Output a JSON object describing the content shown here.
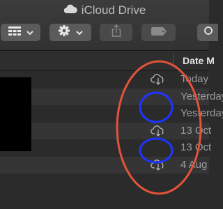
{
  "window": {
    "title": "iCloud Drive"
  },
  "toolbar": {
    "view_button": {
      "icon": "grid-view-icon"
    },
    "action_button": {
      "icon": "gear-icon"
    },
    "share_button": {
      "icon": "share-icon"
    },
    "tags_button": {
      "icon": "tag-icon"
    }
  },
  "columns": {
    "date": "Date M"
  },
  "files": [
    {
      "date": "Today",
      "status_icon": "cloud-download-icon"
    },
    {
      "date": "Yesterday",
      "status_icon": ""
    },
    {
      "date": "Yesterday",
      "status_icon": ""
    },
    {
      "date": "13 Oct",
      "status_icon": "cloud-download-icon"
    },
    {
      "date": "13 Oct",
      "status_icon": ""
    },
    {
      "date": "4 Aug",
      "status_icon": "cloud-download-icon"
    }
  ],
  "colors": {
    "annotation_red": "#e2543a",
    "annotation_blue": "#1d35ff"
  }
}
